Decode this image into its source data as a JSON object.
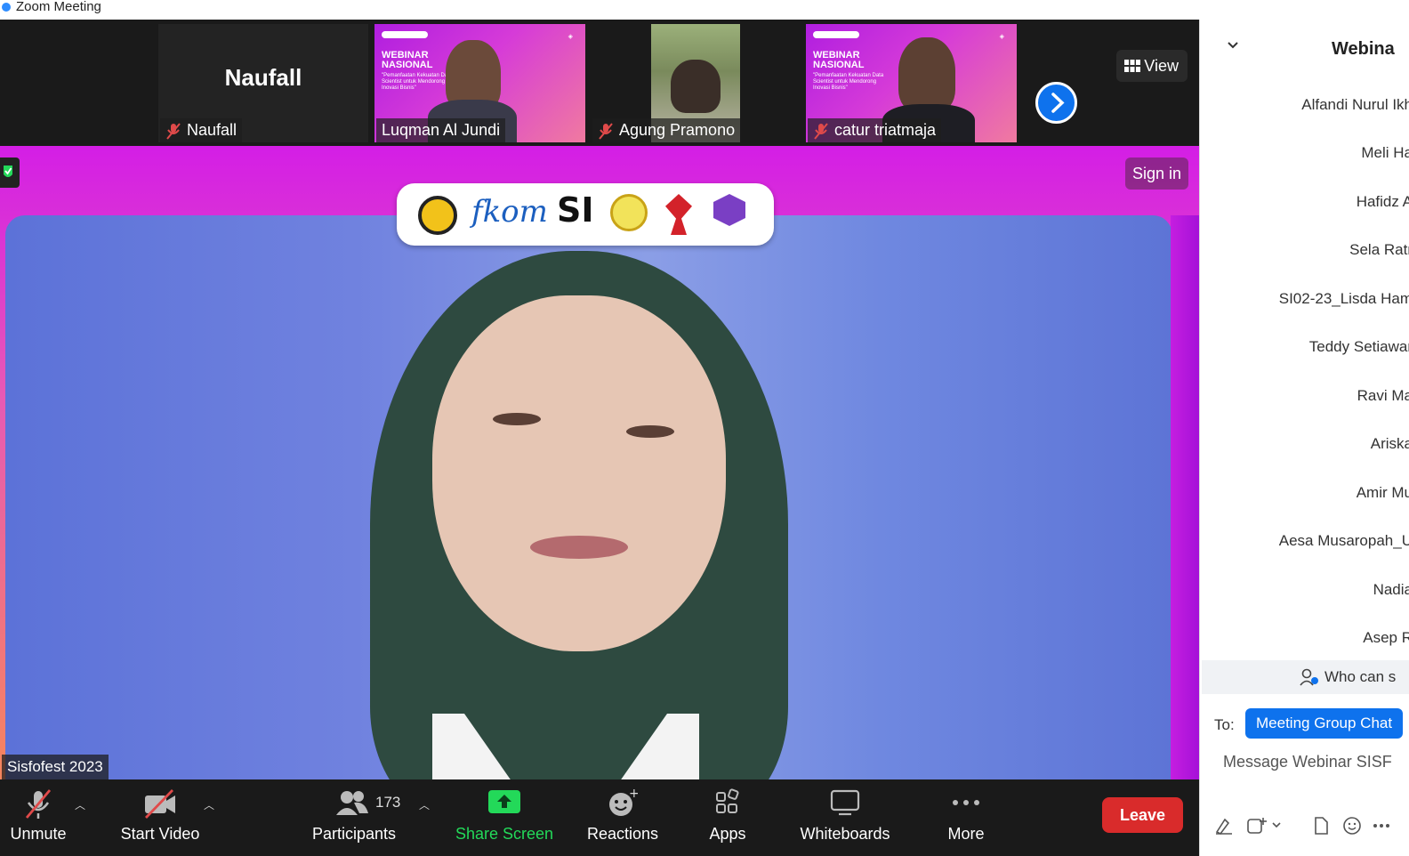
{
  "window": {
    "title": "Zoom Meeting"
  },
  "gallery": {
    "tiles": [
      {
        "name": "Naufall",
        "display_name": "Naufall",
        "muted": true
      },
      {
        "name": "Luqman Al Jundi",
        "muted": false,
        "slide_title": "WEBINAR NASIONAL",
        "slide_sub": "\"Pemanfaatan Kekuatan Data Scientist untuk Mendorong Inovasi Bisnis\""
      },
      {
        "name": "Agung Pramono",
        "muted": true
      },
      {
        "name": "catur triatmaja",
        "muted": true,
        "slide_title": "WEBINAR NASIONAL",
        "slide_sub": "\"Pemanfaatan Kekuatan Data Scientist untuk Mendorong Inovasi Bisnis\""
      }
    ],
    "view_label": "View"
  },
  "main_video": {
    "speaker_label": "Sisfofest 2023",
    "sign_in_label": "Sign in",
    "logos": [
      "fkom",
      "SI"
    ]
  },
  "toolbar": {
    "unmute_label": "Unmute",
    "start_video_label": "Start Video",
    "participants_label": "Participants",
    "participants_count": "173",
    "share_screen_label": "Share Screen",
    "reactions_label": "Reactions",
    "apps_label": "Apps",
    "whiteboards_label": "Whiteboards",
    "more_label": "More",
    "leave_label": "Leave"
  },
  "panel": {
    "title": "Webina",
    "attendees": [
      "Alfandi Nurul Ikh",
      "Meli Ha",
      "Hafidz A",
      "Sela Ratr",
      "SI02-23_Lisda Ham",
      "Teddy Setiawar",
      "Ravi Ma",
      "Ariska",
      "Amir Mu",
      "Aesa Musaropah_U",
      "Nadia",
      "Asep R"
    ],
    "who_can_see": "Who can s",
    "to_label": "To:",
    "to_recipient": "Meeting Group Chat",
    "message_placeholder": "Message Webinar SISF"
  },
  "colors": {
    "accent_blue": "#0e72ed",
    "leave_red": "#d92b2b",
    "share_green": "#23d959",
    "slide_purple": "#c51ee0"
  }
}
